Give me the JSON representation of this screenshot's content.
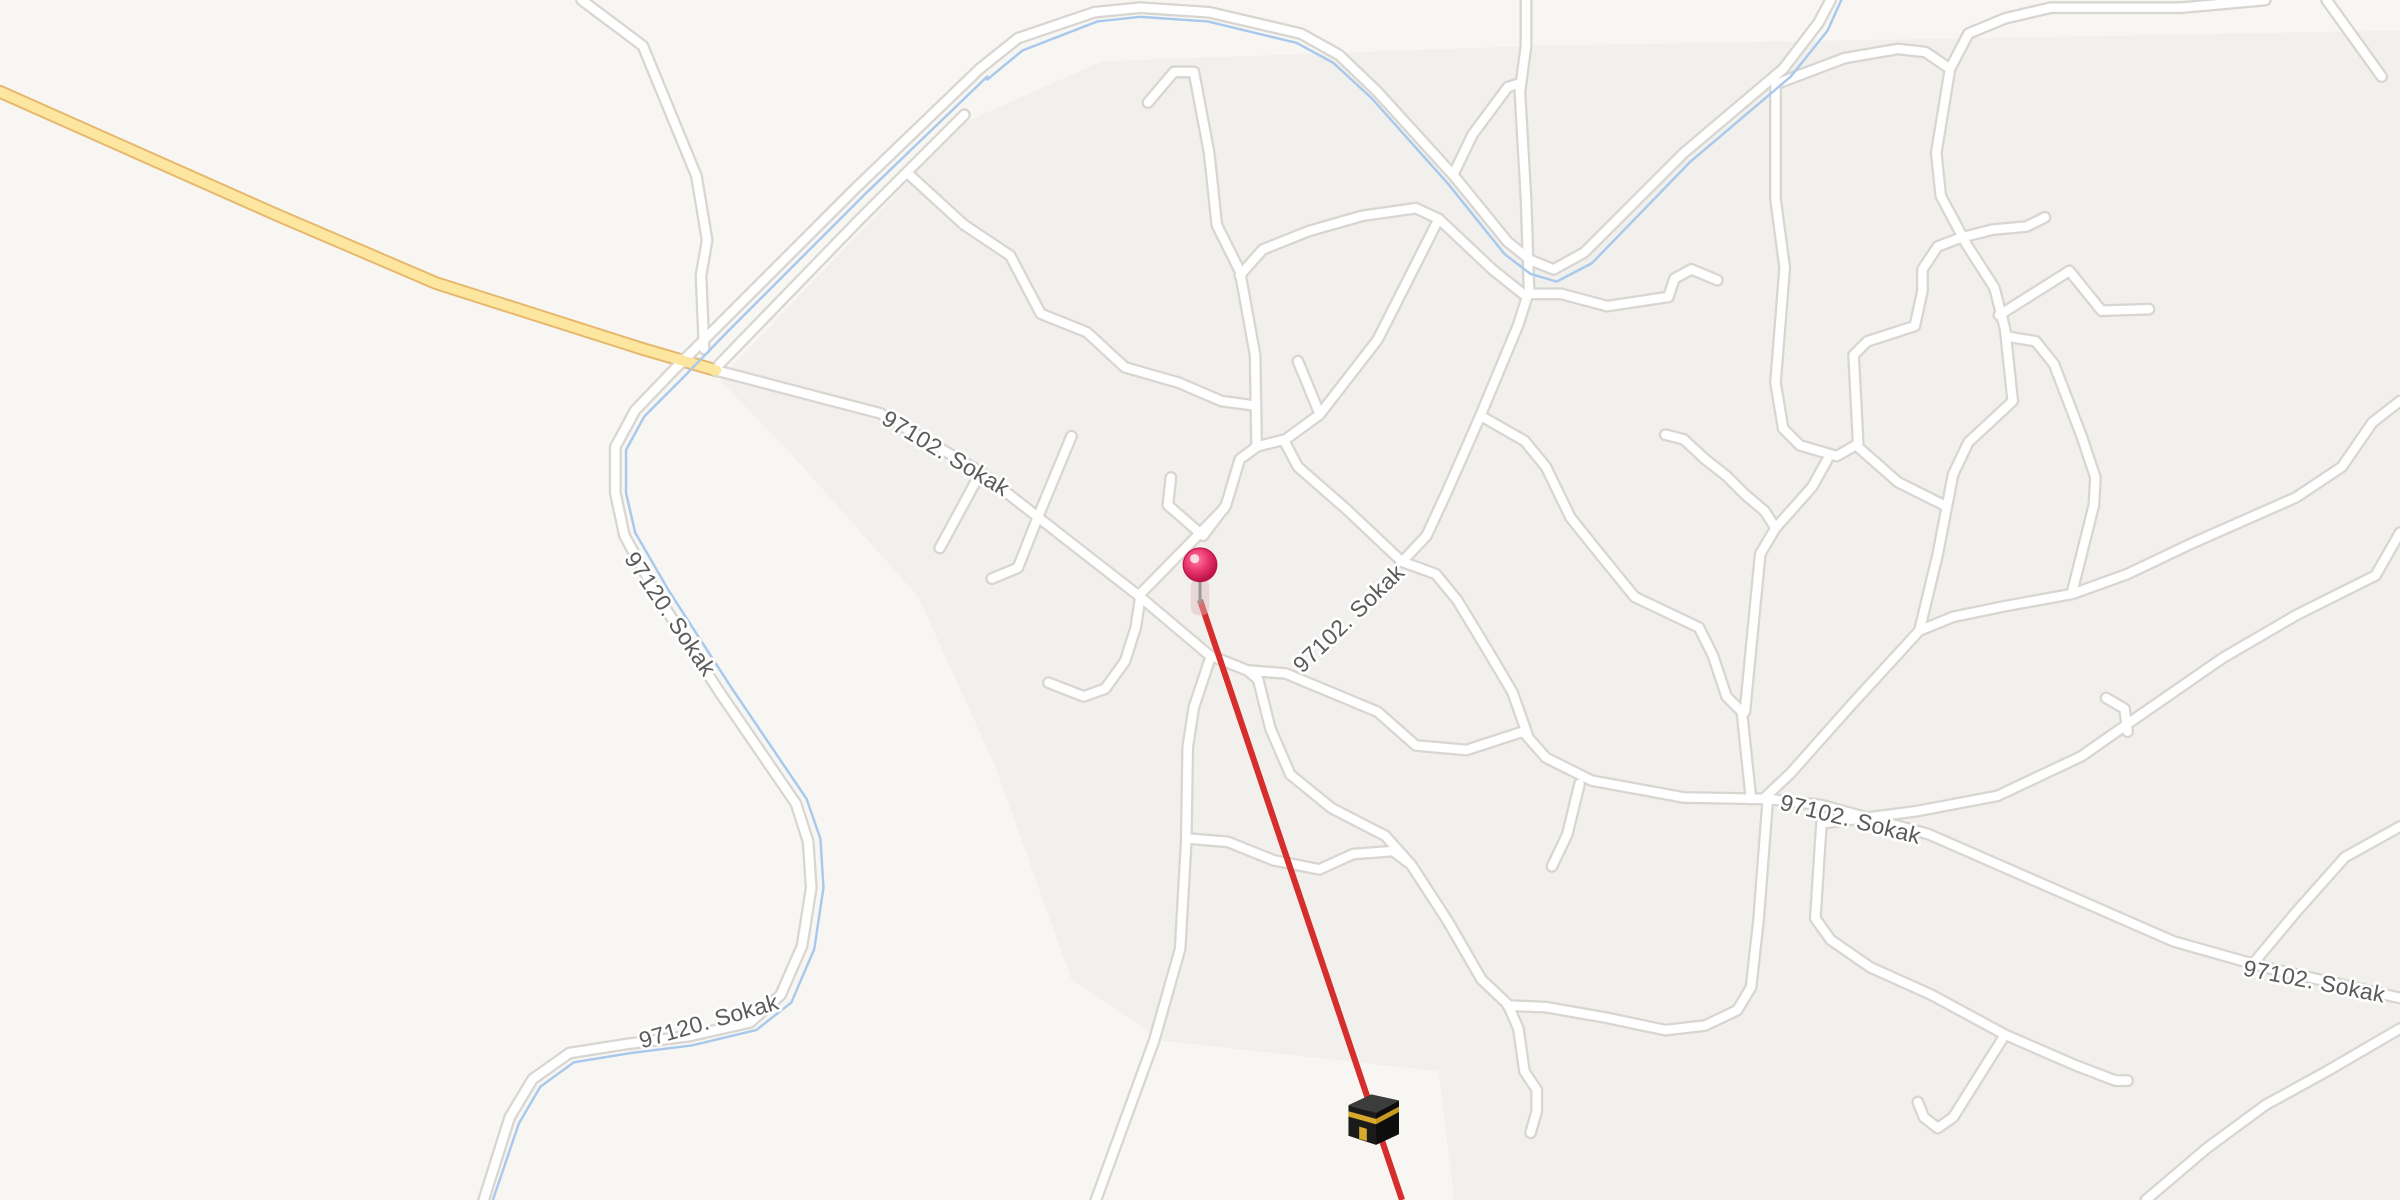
{
  "map": {
    "street_labels": [
      {
        "text": "97102. Sokak"
      },
      {
        "text": "97102. Sokak"
      },
      {
        "text": "97102. Sokak"
      },
      {
        "text": "97102. Sokak"
      },
      {
        "text": "97120. Sokak"
      },
      {
        "text": "97120. Sokak"
      }
    ]
  },
  "markers": {
    "location": {
      "icon": "location-pin-icon",
      "color": "#e8336d"
    },
    "qibla": {
      "icon": "kaaba-icon"
    }
  },
  "colors": {
    "background": "#f8f6f3",
    "residential": "#f2f0ec",
    "road": "#ffffff",
    "road_casing": "#d9d6d1",
    "primary_road": "#fde6a0",
    "primary_road_casing": "#e6b76a",
    "waterway": "#a9c9ec",
    "qibla_line": "#d62d2d",
    "label": "#5a5a5a"
  }
}
